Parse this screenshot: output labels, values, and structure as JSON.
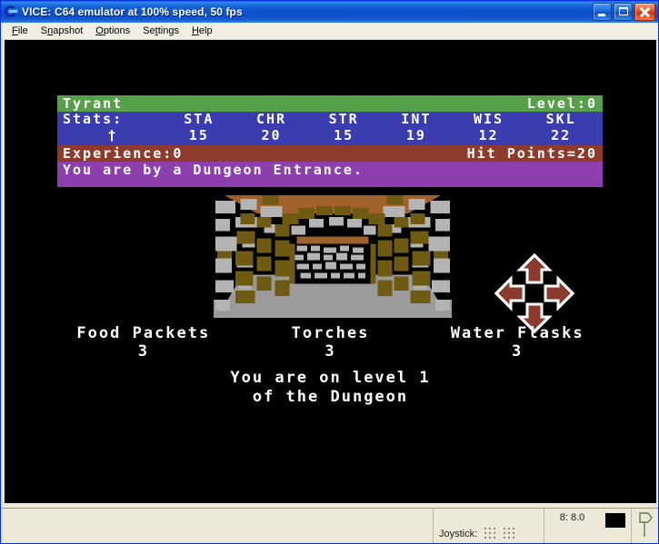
{
  "window": {
    "title": "VICE: C64 emulator at 100% speed, 50 fps",
    "icon": "vice-c-logo-icon",
    "buttons": {
      "minimize": "minimize-button",
      "maximize": "maximize-button",
      "close": "close-button"
    }
  },
  "menubar": {
    "items": [
      {
        "label": "File",
        "accel": "F"
      },
      {
        "label": "Snapshot",
        "accel": "n"
      },
      {
        "label": "Options",
        "accel": "O"
      },
      {
        "label": "Settings",
        "accel": "t"
      },
      {
        "label": "Help",
        "accel": "H"
      }
    ]
  },
  "game": {
    "character_name": "Tyrant",
    "level_label": "Level:0",
    "stats_label": "Stats:",
    "hero_glyph": "†",
    "stat_names": [
      "STA",
      "CHR",
      "STR",
      "INT",
      "WIS",
      "SKL"
    ],
    "stat_values": [
      "15",
      "20",
      "15",
      "19",
      "12",
      "22"
    ],
    "experience": "Experience:0",
    "hit_points": "Hit Points=20",
    "location_message": "You are by a Dungeon Entrance.",
    "inventory": [
      {
        "label": "Food Packets",
        "count": "3"
      },
      {
        "label": "Torches",
        "count": "3"
      },
      {
        "label": "Water Flasks",
        "count": "3"
      }
    ],
    "level_message_line1": "You are on level 1",
    "level_message_line2": "of the Dungeon",
    "compass": {
      "up": "arrow-up-icon",
      "down": "arrow-down-icon",
      "left": "arrow-left-icon",
      "right": "arrow-right-icon"
    },
    "scene": "dungeon-entrance-archway",
    "colors": {
      "title_band": "#55a049",
      "stats_band": "#3b3cb0",
      "experience_band": "#8f3b2c",
      "message_band": "#8e3fae",
      "screen_background": "#000000",
      "text": "#ffffff",
      "stone_light": "#b4b4b4",
      "stone_dark": "#6e5a10",
      "arch_brown": "#a0622a",
      "floor": "#9b9b9b",
      "arrow_red": "#8c3a2e"
    }
  },
  "statusbar": {
    "joystick_label": "Joystick:",
    "joystick_port1": "joystick-port-1-grid",
    "joystick_port2": "joystick-port-2-grid",
    "drive_status": "8: 8.0",
    "drive_led": "drive-led-off",
    "tape_icon": "datasette-icon"
  }
}
